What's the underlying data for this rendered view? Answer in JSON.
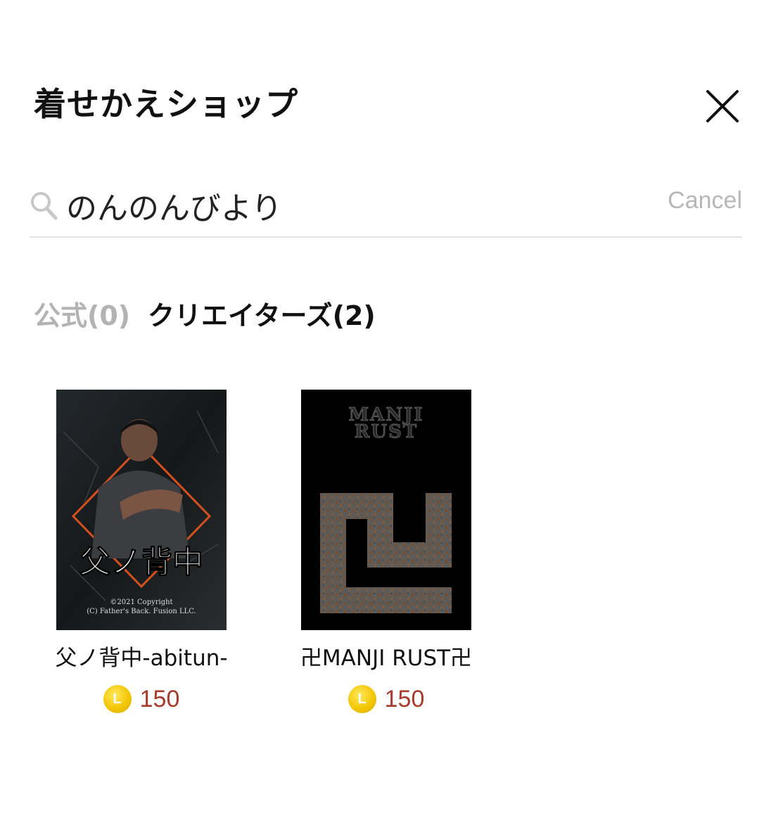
{
  "header": {
    "title": "着せかえショップ"
  },
  "search": {
    "query": "のんのんびより",
    "cancel_label": "Cancel"
  },
  "tabs": [
    {
      "label": "公式(0)",
      "active": false
    },
    {
      "label": "クリエイターズ(2)",
      "active": true
    }
  ],
  "items": [
    {
      "title": "父ノ背中-abitun-",
      "price": "150",
      "coin_letter": "L",
      "thumb": {
        "caption": "父ノ背中",
        "copyright_1": "©2021 Copyright",
        "copyright_2": "(C) Father's Back. Fusion LLC."
      }
    },
    {
      "title": "卍MANJI RUST卍",
      "price": "150",
      "coin_letter": "L",
      "thumb": {
        "caption_1": "MANJI",
        "caption_2": "RUST"
      }
    }
  ],
  "colors": {
    "price": "#a83a2a",
    "coin": "#f1c400",
    "inactive_tab": "#b3b3b3",
    "accent_orange": "#d4501e"
  }
}
